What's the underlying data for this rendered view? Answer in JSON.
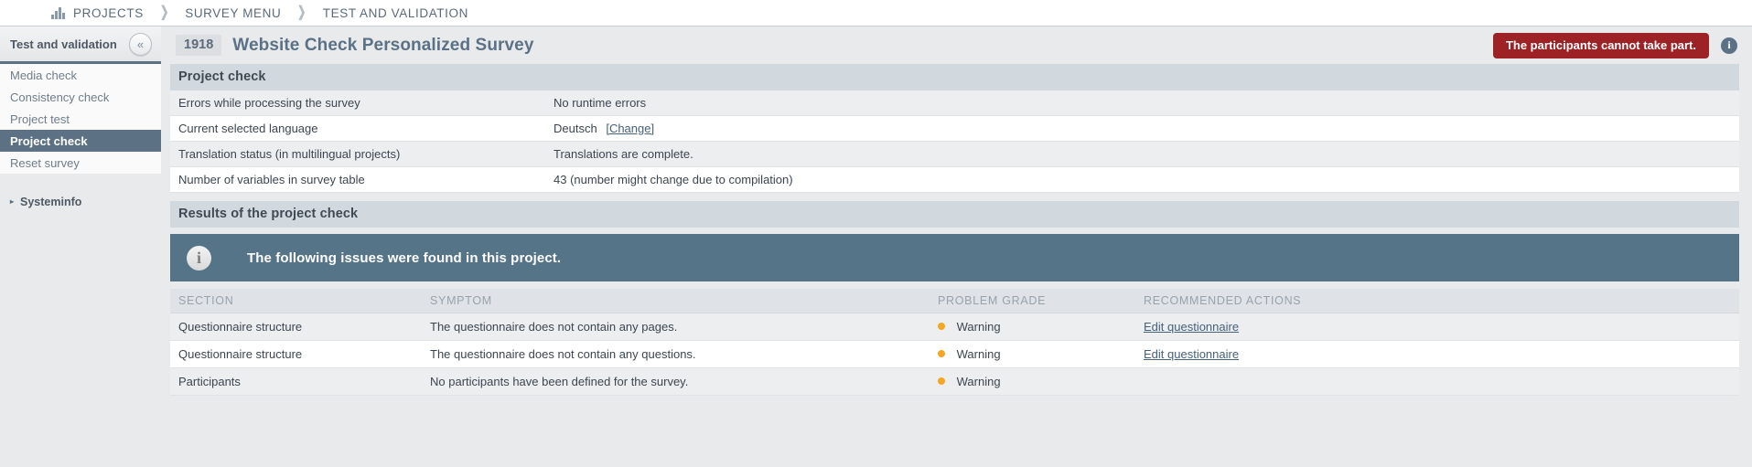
{
  "breadcrumb": {
    "icon": "bar-chart-icon",
    "separator": "❯",
    "items": [
      "PROJECTS",
      "SURVEY MENU",
      "TEST AND VALIDATION"
    ]
  },
  "sidebar": {
    "title": "Test and validation",
    "collapse_icon": "«",
    "items": [
      {
        "label": "Media check",
        "active": false
      },
      {
        "label": "Consistency check",
        "active": false
      },
      {
        "label": "Project test",
        "active": false
      },
      {
        "label": "Project check",
        "active": true
      },
      {
        "label": "Reset survey",
        "active": false
      }
    ],
    "section": {
      "arrow": "▸",
      "label": "Systeminfo"
    }
  },
  "header": {
    "project_id": "1918",
    "title": "Website Check Personalized Survey",
    "status_badge": "The participants cannot take part.",
    "info_icon": "i"
  },
  "project_check": {
    "panel_title": "Project check",
    "rows": [
      {
        "key": "Errors while processing the survey",
        "value": "No runtime errors",
        "link": ""
      },
      {
        "key": "Current selected language",
        "value": "Deutsch",
        "link": "[Change]"
      },
      {
        "key": "Translation status (in multilingual projects)",
        "value": "Translations are complete.",
        "link": ""
      },
      {
        "key": "Number of variables in survey table",
        "value": "43 (number might change due to compilation)",
        "link": ""
      }
    ]
  },
  "results": {
    "panel_title": "Results of the project check",
    "notice": {
      "icon": "info-icon",
      "text": "The following issues were found in this project."
    },
    "columns": [
      "SECTION",
      "SYMPTOM",
      "PROBLEM GRADE",
      "RECOMMENDED ACTIONS"
    ],
    "rows": [
      {
        "section": "Questionnaire structure",
        "symptom": "The questionnaire does not contain any pages.",
        "grade": "Warning",
        "action": "Edit questionnaire"
      },
      {
        "section": "Questionnaire structure",
        "symptom": "The questionnaire does not contain any questions.",
        "grade": "Warning",
        "action": "Edit questionnaire"
      },
      {
        "section": "Participants",
        "symptom": "No participants have been defined for the survey.",
        "grade": "Warning",
        "action": ""
      }
    ]
  },
  "colors": {
    "accent": "#5c7284",
    "notice_bg": "#557488",
    "danger": "#9d2226",
    "warning": "#f5a623",
    "link": "#46617a"
  }
}
